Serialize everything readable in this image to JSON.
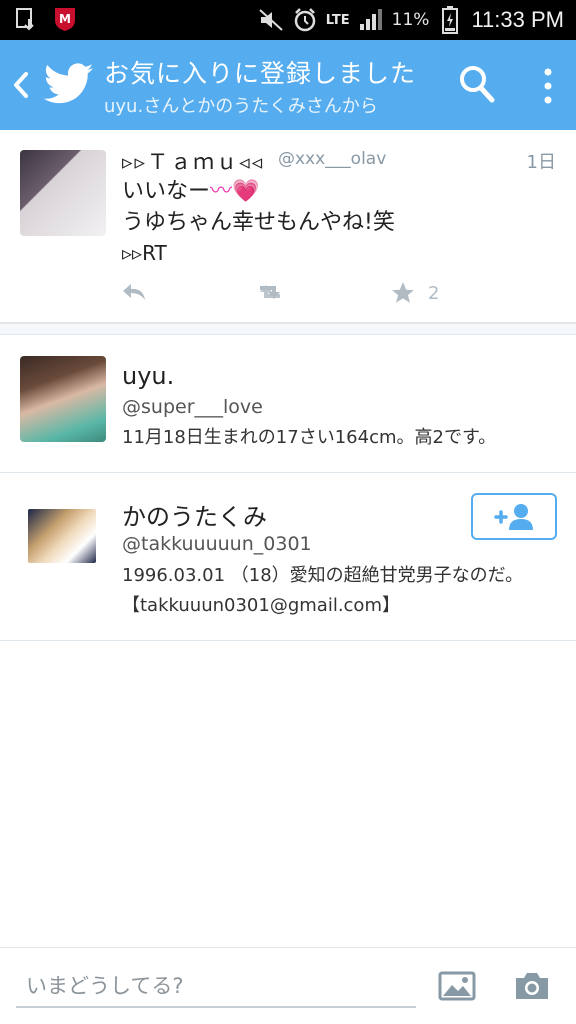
{
  "status_bar": {
    "battery": "11%",
    "network": "LTE",
    "time": "11:33 PM",
    "icons": [
      "download-icon",
      "mcafee-icon",
      "mute-icon",
      "alarm-icon",
      "lte-icon",
      "signal-icon",
      "battery-charging-icon"
    ]
  },
  "header": {
    "title": "お気に入りに登録しました",
    "subtitle": "uyu.さんとかのうたくみさんから",
    "accent_color": "#55acee"
  },
  "tweet": {
    "name": "▹▹Ｔａｍｕ◃◃",
    "handle": "@xxx___olav",
    "time": "1日",
    "lines": [
      "いいなー<span>〰</span>💗",
      "うゆちゃん幸せもんやね!笑",
      "▹▹RT"
    ],
    "line1_text": "いいなー",
    "line1_emoji": "〰💗",
    "line2": "うゆちゃん幸せもんやね!笑",
    "line3": "▹▹RT",
    "favorite_count": "2"
  },
  "users": [
    {
      "name": "uyu.",
      "handle": "@super___love",
      "bio": [
        "11月18日生まれの17さい164cm。高2です。"
      ]
    },
    {
      "name": "かのうたくみ",
      "handle": "@takkuuuuun_0301",
      "bio": [
        "1996.03.01 （18）愛知の超絶甘党男子なのだ。",
        "【takkuuun0301@gmail.com】"
      ]
    }
  ],
  "compose": {
    "placeholder": "いまどうしてる?"
  }
}
